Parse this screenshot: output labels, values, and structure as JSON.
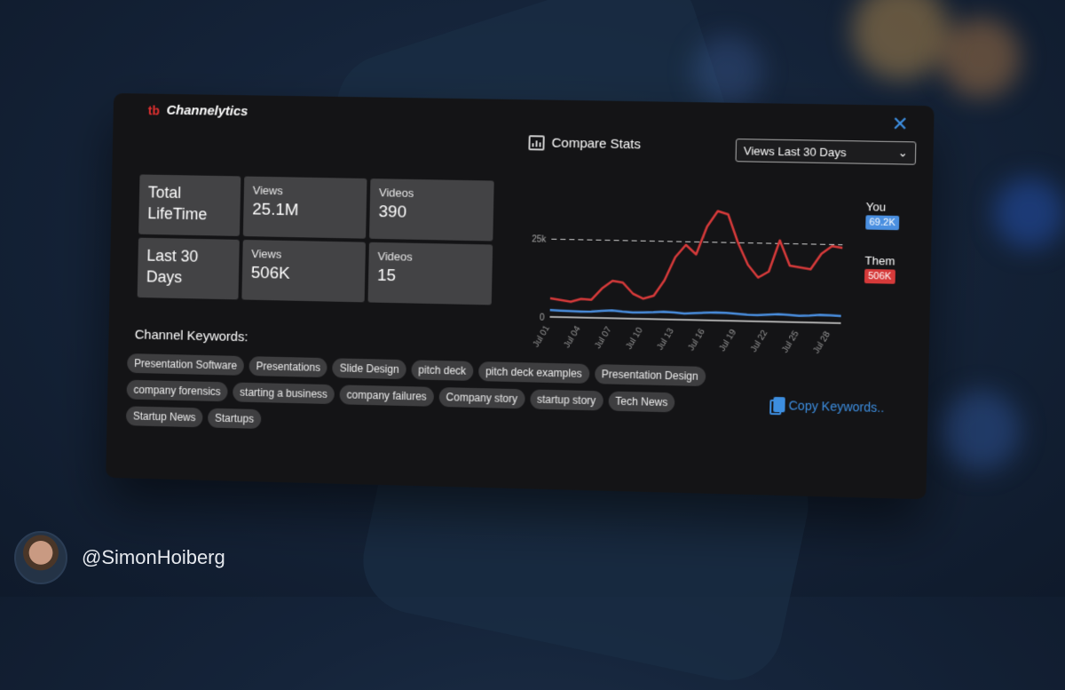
{
  "app": {
    "logo_text": "tb",
    "name": "Channelytics",
    "close_glyph": "✕"
  },
  "stats": {
    "lifetime": {
      "period": "Total LifeTime",
      "views_label": "Views",
      "views_value": "25.1M",
      "videos_label": "Videos",
      "videos_value": "390"
    },
    "last30": {
      "period": "Last 30 Days",
      "views_label": "Views",
      "views_value": "506K",
      "videos_label": "Videos",
      "videos_value": "15"
    }
  },
  "compare": {
    "title": "Compare Stats",
    "icon": "bar-chart-icon",
    "select_value": "Views Last 30 Days",
    "select_arrow": "⌄"
  },
  "chart_data": {
    "type": "line",
    "x": [
      "Jul 01",
      "Jul 02",
      "Jul 03",
      "Jul 04",
      "Jul 05",
      "Jul 06",
      "Jul 07",
      "Jul 08",
      "Jul 09",
      "Jul 10",
      "Jul 11",
      "Jul 12",
      "Jul 13",
      "Jul 14",
      "Jul 15",
      "Jul 16",
      "Jul 17",
      "Jul 18",
      "Jul 19",
      "Jul 20",
      "Jul 21",
      "Jul 22",
      "Jul 23",
      "Jul 24",
      "Jul 25",
      "Jul 26",
      "Jul 27",
      "Jul 28",
      "Jul 29"
    ],
    "x_tick_labels": [
      "Jul 01",
      "Jul 04",
      "Jul 07",
      "Jul 10",
      "Jul 13",
      "Jul 16",
      "Jul 19",
      "Jul 22",
      "Jul 25",
      "Jul 28"
    ],
    "y_tick_labels": [
      "0",
      "25k"
    ],
    "ylim": [
      0,
      40000
    ],
    "reference_line": 25000,
    "series": [
      {
        "name": "Them",
        "color": "#d63a3a",
        "values": [
          6000,
          5500,
          5000,
          6000,
          5800,
          9500,
          12000,
          11500,
          8000,
          6500,
          7500,
          12500,
          20000,
          24000,
          21000,
          30000,
          35000,
          34000,
          25000,
          18000,
          14000,
          16000,
          26000,
          18000,
          17500,
          17000,
          22000,
          24500,
          24000
        ]
      },
      {
        "name": "You",
        "color": "#4a8fe0",
        "values": [
          2200,
          2100,
          2000,
          1900,
          2000,
          2300,
          2500,
          2200,
          2000,
          2100,
          2200,
          2400,
          2300,
          2000,
          2200,
          2400,
          2600,
          2500,
          2300,
          2100,
          2000,
          2200,
          2400,
          2300,
          2100,
          2200,
          2500,
          2400,
          2300
        ]
      }
    ]
  },
  "legend": {
    "you_label": "You",
    "you_value": "69.2K",
    "you_color": "#4a8fe0",
    "them_label": "Them",
    "them_value": "506K",
    "them_color": "#d63a3a"
  },
  "keywords": {
    "title": "Channel Keywords:",
    "items": [
      "Presentation Software",
      "Presentations",
      "Slide Design",
      "pitch deck",
      "pitch deck examples",
      "Presentation Design",
      "company forensics",
      "starting a business",
      "company failures",
      "Company story",
      "startup story",
      "Tech News",
      "Startup News",
      "Startups"
    ],
    "copy_label": "Copy Keywords.."
  },
  "author": {
    "handle": "@SimonHoiberg"
  }
}
